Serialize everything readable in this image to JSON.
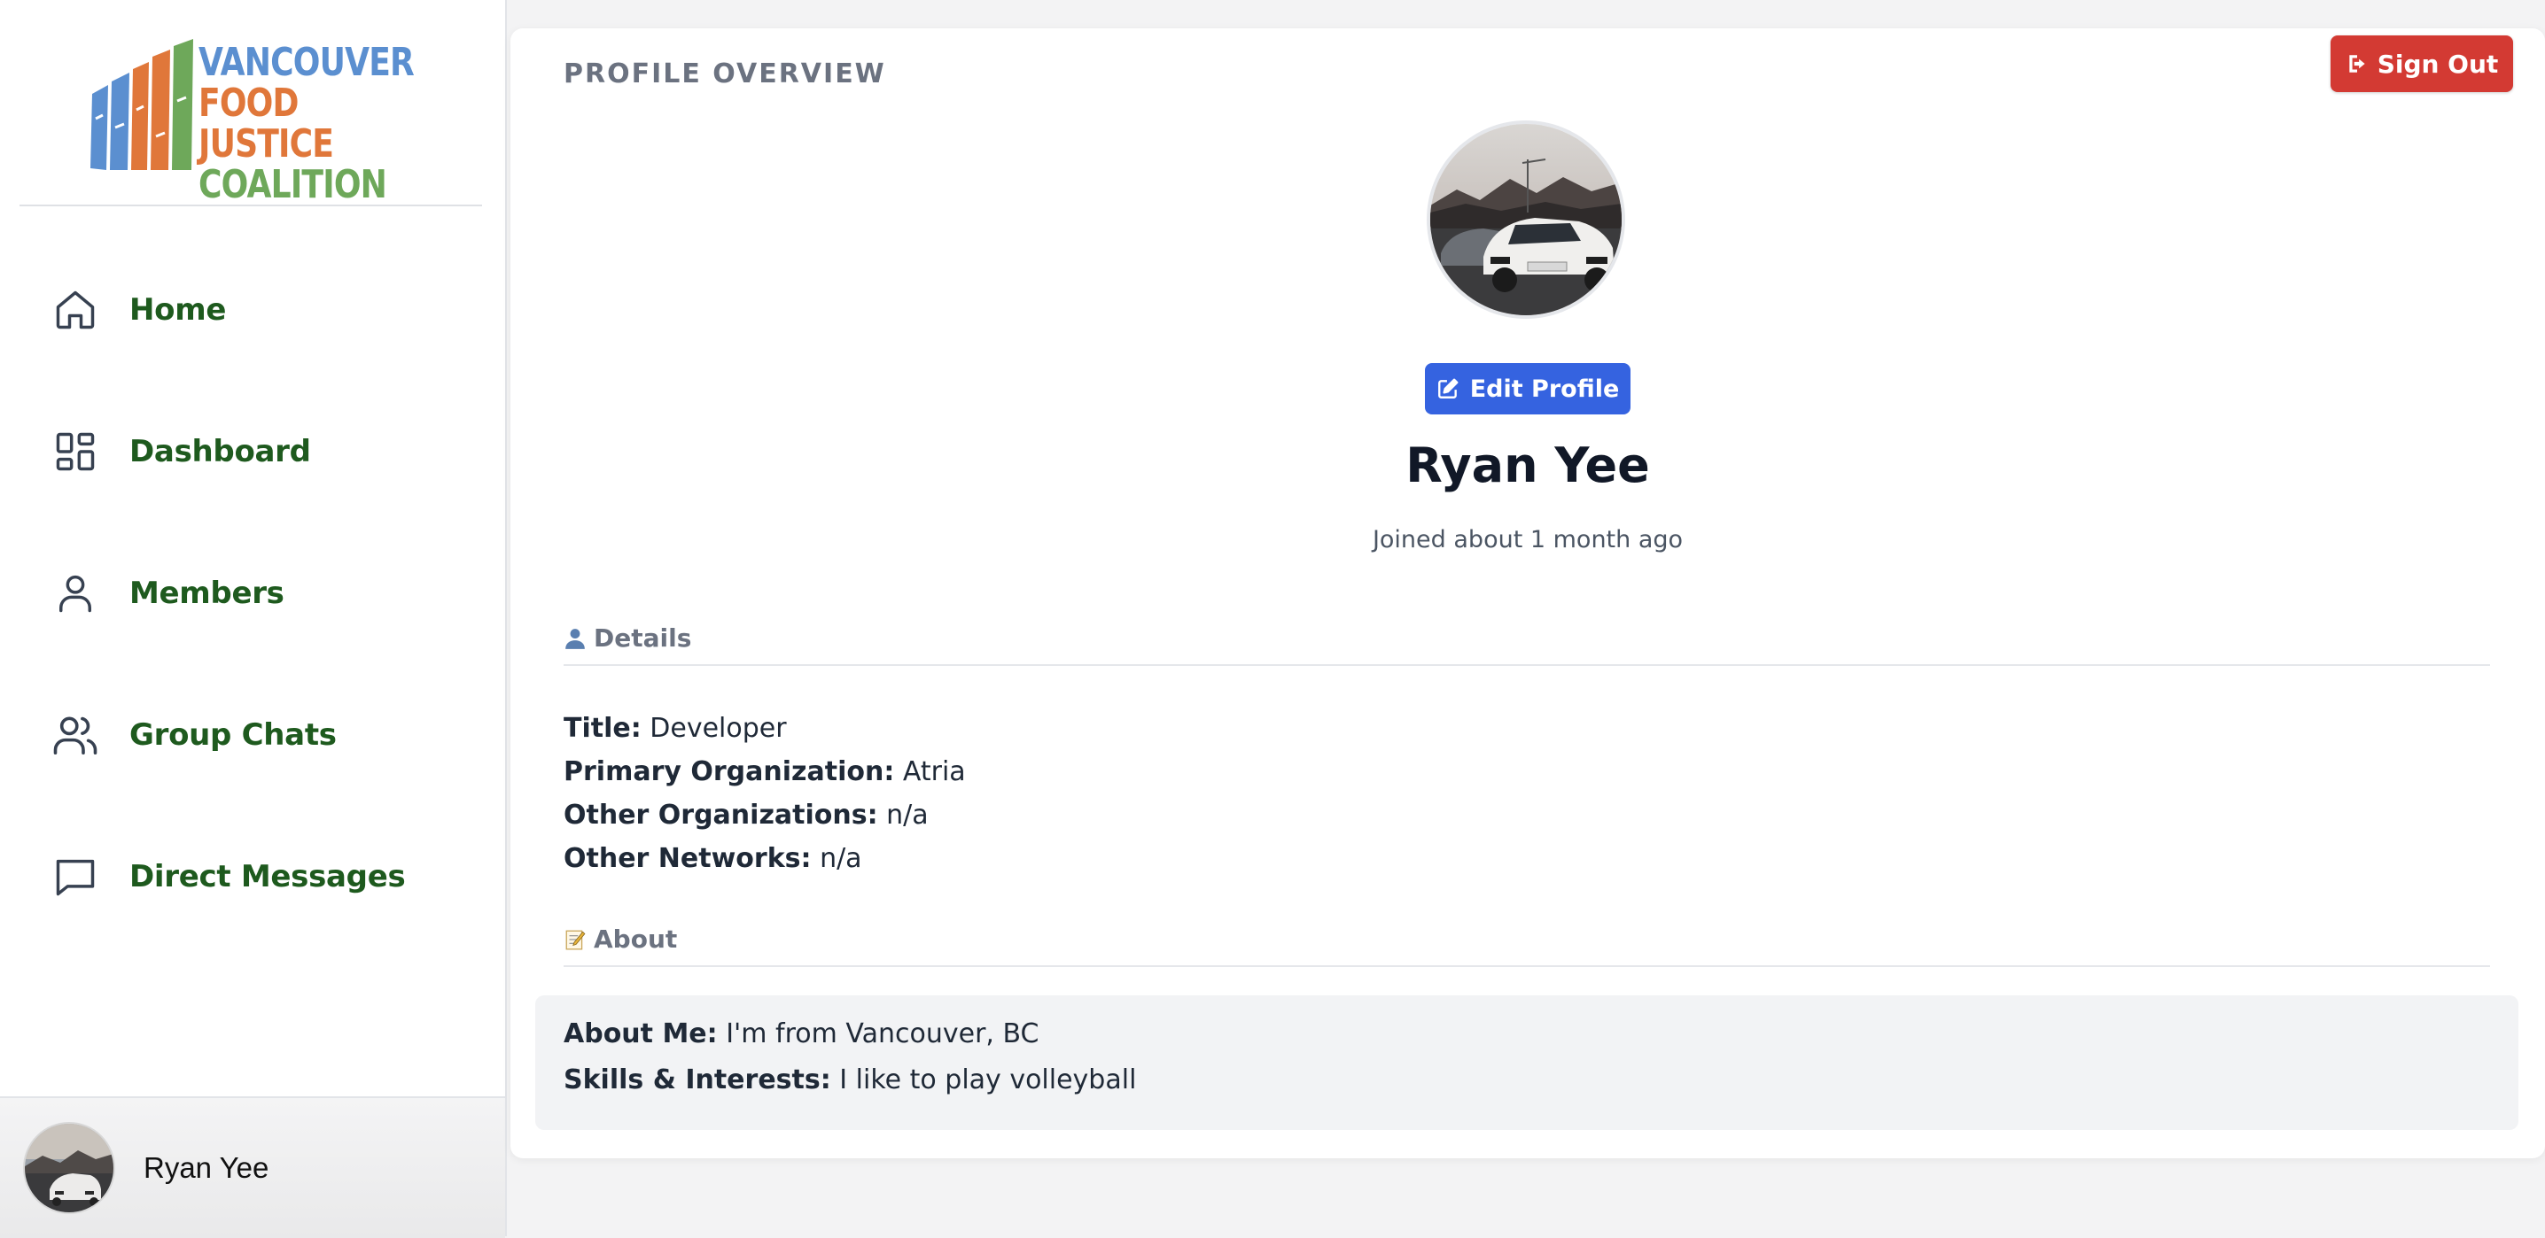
{
  "logo": {
    "line1": "VANCOUVER",
    "line2": "FOOD JUSTICE",
    "line3": "COALITION",
    "colors": {
      "blue": "#5b8fd0",
      "orange": "#e0773a",
      "green": "#6ea85a"
    }
  },
  "sidebar": {
    "items": [
      {
        "label": "Home",
        "icon": "home-icon"
      },
      {
        "label": "Dashboard",
        "icon": "dashboard-icon"
      },
      {
        "label": "Members",
        "icon": "user-icon"
      },
      {
        "label": "Group Chats",
        "icon": "users-icon"
      },
      {
        "label": "Direct Messages",
        "icon": "chat-bubble-icon"
      }
    ],
    "label_color": "#1e5a1e",
    "user": {
      "name": "Ryan Yee"
    }
  },
  "header": {
    "title": "PROFILE OVERVIEW",
    "sign_out_label": "Sign Out",
    "sign_out_color": "#d33a33"
  },
  "profile": {
    "edit_label": "Edit Profile",
    "edit_color": "#3563e0",
    "name": "Ryan Yee",
    "joined": "Joined about 1 month ago"
  },
  "details": {
    "header": "Details",
    "rows": [
      {
        "label": "Title:",
        "value": "Developer"
      },
      {
        "label": "Primary Organization:",
        "value": "Atria"
      },
      {
        "label": "Other Organizations:",
        "value": "n/a"
      },
      {
        "label": "Other Networks:",
        "value": "n/a"
      }
    ]
  },
  "about": {
    "header": "About",
    "rows": [
      {
        "label": "About Me:",
        "value": "I'm from Vancouver, BC"
      },
      {
        "label": "Skills & Interests:",
        "value": "I like to play volleyball"
      }
    ]
  }
}
